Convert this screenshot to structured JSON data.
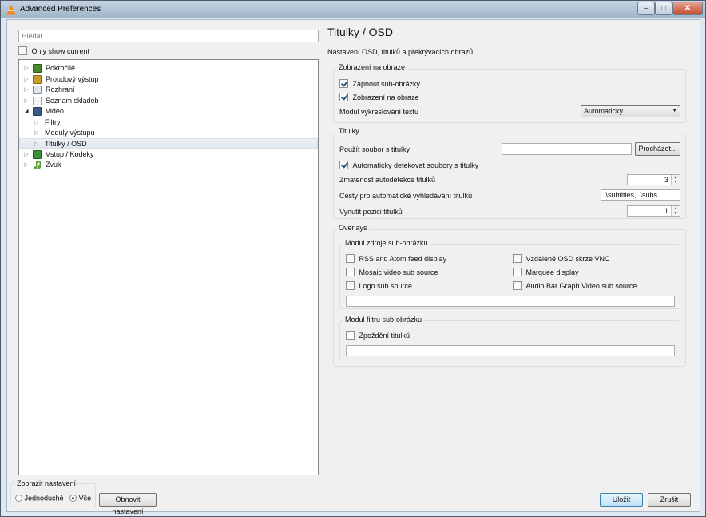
{
  "window": {
    "title": "Advanced Preferences",
    "minimize": "‒",
    "maximize": "□",
    "close": "✕"
  },
  "search": {
    "placeholder": "Hledat"
  },
  "only_show_current": {
    "label": "Only show current",
    "checked": false
  },
  "tree": {
    "items": [
      {
        "label": "Pokročilé",
        "arrow": "▷",
        "icon": "advanced-icon",
        "color": "#4a8a2a"
      },
      {
        "label": "Proudový výstup",
        "arrow": "▷",
        "icon": "stream-output-icon",
        "color": "#c99a2e"
      },
      {
        "label": "Rozhraní",
        "arrow": "▷",
        "icon": "interface-icon",
        "color": "#7a8ea0"
      },
      {
        "label": "Seznam skladeb",
        "arrow": "▷",
        "icon": "playlist-icon",
        "color": "#9aa6b2"
      },
      {
        "label": "Video",
        "arrow": "◢",
        "icon": "video-icon",
        "color": "#3d5a8a"
      },
      {
        "label": "Filtry",
        "arrow": "▷"
      },
      {
        "label": "Moduly výstupu",
        "arrow": "▷"
      },
      {
        "label": "Titulky / OSD",
        "arrow": "▷"
      },
      {
        "label": "Vstup / Kodeky",
        "arrow": "▷",
        "icon": "input-codecs-icon",
        "color": "#3f8f3a"
      },
      {
        "label": "Zvuk",
        "arrow": "▷",
        "icon": "audio-icon",
        "color": "#5aa03a"
      }
    ]
  },
  "footer": {
    "mode_legend": "Zobrazit nastavení",
    "simple_label": "Jednoduché",
    "all_label": "Vše",
    "reset_label": "Obnovit nastavení",
    "save_label": "Uložit",
    "cancel_label": "Zrušit"
  },
  "page": {
    "title": "Titulky / OSD",
    "description": "Nastavení OSD, titulků a překrývacích obrazů"
  },
  "osd_group": {
    "legend": "Zobrazení na obraze",
    "enable_subpictures": {
      "label": "Zapnout sub-obrázky",
      "checked": true
    },
    "on_screen_display": {
      "label": "Zobrazení na obraze",
      "checked": true
    },
    "text_renderer_label": "Modul vykreslování textu",
    "text_renderer_value": "Automaticky"
  },
  "subtitles_group": {
    "legend": "Titulky",
    "use_file_label": "Použít soubor s titulky",
    "use_file_value": "",
    "browse_label": "Procházet...",
    "autodetect": {
      "label": "Automaticky detekovat soubory s titulky",
      "checked": true
    },
    "fuzziness_label": "Zmatenost autodetekce titulků",
    "fuzziness_value": "3",
    "paths_label": "Cesty pro automatické vyhledávání titulků",
    "paths_value": ".\\subtitles, .\\subs",
    "force_position_label": "Vynutit pozici titulků",
    "force_position_value": "1"
  },
  "overlays_group": {
    "legend": "Overlays",
    "source_legend": "Modul zdroje sub-obrázku",
    "sources": [
      {
        "label": "RSS and Atom feed display",
        "checked": false
      },
      {
        "label": "Vzdálené OSD skrze VNC",
        "checked": false
      },
      {
        "label": "Mosaic video sub source",
        "checked": false
      },
      {
        "label": "Marquee display",
        "checked": false
      },
      {
        "label": "Logo sub source",
        "checked": false
      },
      {
        "label": "Audio Bar Graph Video sub source",
        "checked": false
      }
    ],
    "filter_legend": "Modul filtru sub-obrázku",
    "filters": [
      {
        "label": "Zpoždění titulků",
        "checked": false
      }
    ]
  }
}
